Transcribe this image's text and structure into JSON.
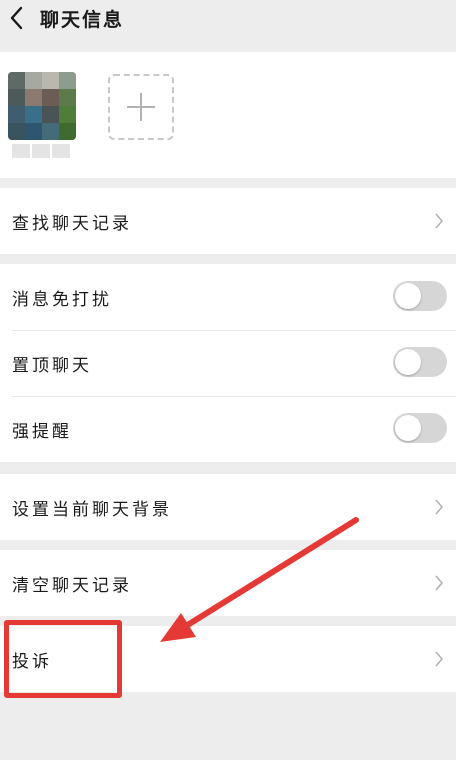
{
  "header": {
    "title": "聊天信息"
  },
  "members": {
    "add_label": "+"
  },
  "rows": {
    "search_history": "查找聊天记录",
    "mute": "消息免打扰",
    "pin": "置顶聊天",
    "strong_reminder": "强提醒",
    "set_background": "设置当前聊天背景",
    "clear_history": "清空聊天记录",
    "report": "投诉"
  },
  "toggles": {
    "mute": false,
    "pin": false,
    "strong_reminder": false
  },
  "icons": {
    "back": "chevron-left-icon",
    "add": "plus-icon",
    "row_arrow": "chevron-right-icon"
  },
  "colors": {
    "page_background": "#ededed",
    "card_background": "#ffffff",
    "toggle_off": "#d6d6d6",
    "annotation": "#e53935"
  }
}
